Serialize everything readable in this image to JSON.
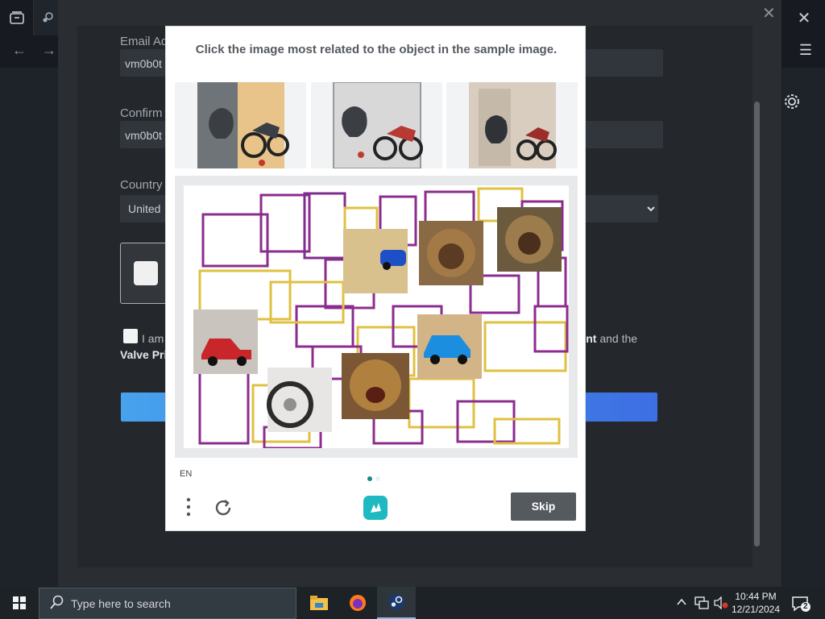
{
  "window": {
    "close_glyph": "✕",
    "back_glyph": "←",
    "forward_glyph": "→",
    "menu_glyph": "☰",
    "overlay_close_glyph": "✕"
  },
  "signup": {
    "email_label": "Email Ad",
    "email_value": "vm0b0t",
    "confirm_label": "Confirm",
    "confirm_value": "vm0b0t",
    "country_label": "Country",
    "country_value": "United",
    "agree_text": "I am",
    "agree_suffix_bold": "ment",
    "agree_suffix": " and the",
    "privacy_text": "Valve Pri"
  },
  "captcha": {
    "prompt": "Click the image most related to the object in the sample image.",
    "language": "EN",
    "skip_label": "Skip",
    "accent": "#1a8a88",
    "sample_images": [
      "sample-image-1",
      "sample-image-2",
      "sample-image-3"
    ],
    "canvas_images": [
      "toy-car-blue-small",
      "lion-face-1",
      "lion-face-2",
      "red-toy-car",
      "motorcycle-wheel",
      "lion-roaring",
      "blue-toy-car"
    ]
  },
  "taskbar": {
    "search_placeholder": "Type here to search",
    "time": "10:44 PM",
    "date": "12/21/2024",
    "notification_count": "2"
  },
  "colors": {
    "steam_dark": "#171a21",
    "continue_blue": "#47a2ec",
    "taskbar": "#1d2226"
  }
}
